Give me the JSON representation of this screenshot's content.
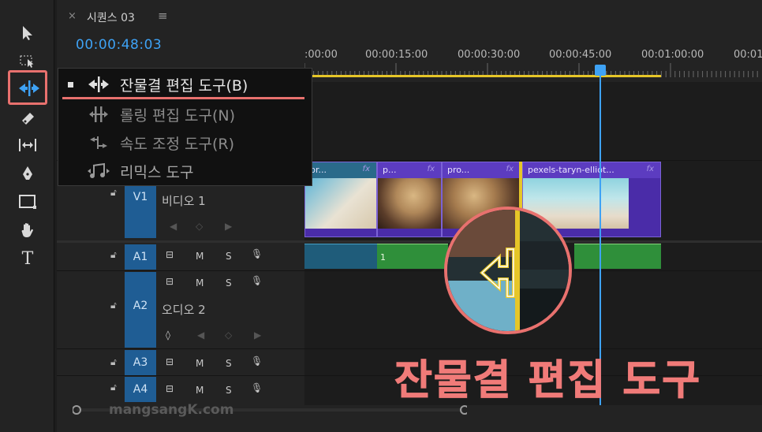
{
  "sequence_tab": {
    "close": "×",
    "title": "시퀀스 03",
    "menu": "≡"
  },
  "timecode": "00:00:48:03",
  "ruler_labels": [
    ":00:00",
    "00:00:15:00",
    "00:00:30:00",
    "00:00:45:00",
    "00:01:00:00",
    "00:01"
  ],
  "tools": [
    "selection-tool",
    "track-select-tool",
    "ripple-edit-tool",
    "razor-tool",
    "slip-tool",
    "pen-tool",
    "rectangle-tool",
    "hand-tool",
    "type-tool"
  ],
  "tool_type_glyph": "T",
  "menu": {
    "items": [
      {
        "label": "잔물결 편집 도구(B)",
        "selected": true
      },
      {
        "label": "롤링 편집 도구(N)",
        "selected": false
      },
      {
        "label": "속도 조정 도구(R)",
        "selected": false
      },
      {
        "label": "리믹스 도구",
        "selected": false
      }
    ]
  },
  "tracks": {
    "v1": {
      "label": "V1",
      "name": "비디오 1"
    },
    "a1": {
      "label": "A1"
    },
    "a2": {
      "label": "A2",
      "name": "오디오 2"
    },
    "a3": {
      "label": "A3"
    },
    "a4": {
      "label": "A4"
    },
    "buttons": {
      "m": "M",
      "s": "S"
    }
  },
  "clips": [
    {
      "name": "pr...",
      "fx": "fx"
    },
    {
      "name": "p...",
      "fx": "fx"
    },
    {
      "name": "pro...",
      "fx": "fx"
    },
    {
      "name": "pexels-taryn-elliot...",
      "fx": "fx"
    }
  ],
  "audio_clip_marker": "1",
  "caption": "잔물결 편집 도구",
  "watermark": "mangsangK.com",
  "colors": {
    "accent": "#e8716e",
    "playhead": "#3ea2f5",
    "clip": "#4a2ca8",
    "audio": "#2f8f3a"
  }
}
